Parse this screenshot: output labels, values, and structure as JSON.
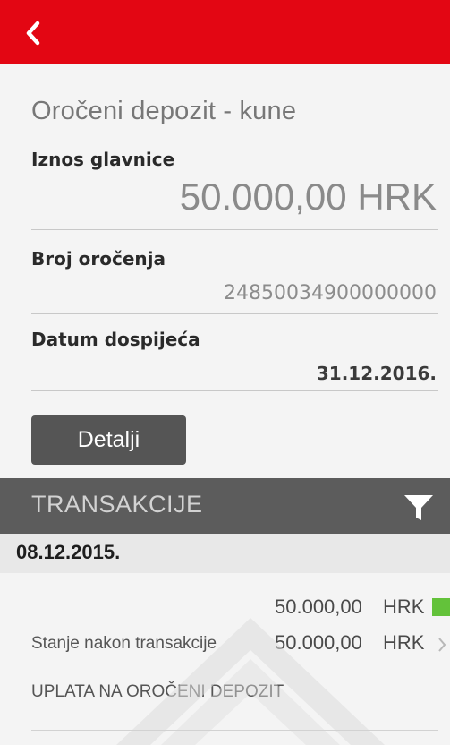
{
  "header": {
    "back_icon": "chevron-left-icon",
    "bar_color": "#e30613"
  },
  "account": {
    "title": "Oročeni depozit - kune",
    "principal_label": "Iznos glavnice",
    "principal_value": "50.000,00 HRK",
    "number_label": "Broj oročenja",
    "number_value": "24850034900000000",
    "due_label": "Datum dospijeća",
    "due_value": "31.12.2016."
  },
  "details_button": {
    "label": "Detalji"
  },
  "transactions": {
    "header_label": "TRANSAKCIJE",
    "filter_icon": "filter-icon",
    "groups": [
      {
        "date": "08.12.2015.",
        "amount": "50.000,00",
        "currency": "HRK",
        "status_color": "#63c23a",
        "balance_label": "Stanje nakon transakcije",
        "balance_amount": "50.000,00",
        "balance_currency": "HRK",
        "description": "UPLATA NA OROČENI DEPOZIT"
      }
    ]
  }
}
